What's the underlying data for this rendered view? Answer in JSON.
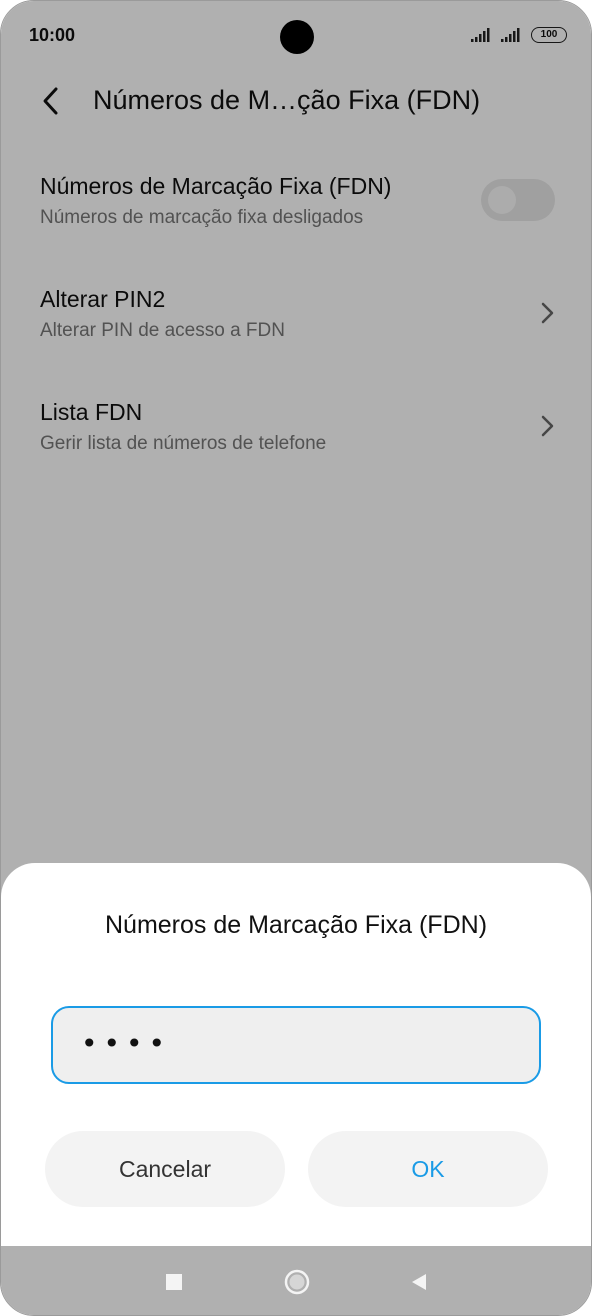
{
  "status_bar": {
    "time": "10:00",
    "battery": "100",
    "icons": [
      "signal-icon",
      "signal-icon",
      "battery-icon"
    ]
  },
  "toolbar": {
    "title": "Números de M…ção Fixa (FDN)",
    "back_icon": "chevron-left-icon"
  },
  "settings": {
    "items": [
      {
        "title": "Números de Marcação Fixa (FDN)",
        "subtitle": "Números de marcação fixa desligados",
        "control": "toggle",
        "enabled": false
      },
      {
        "title": "Alterar PIN2",
        "subtitle": "Alterar PIN de acesso a FDN",
        "control": "chevron-right-icon"
      },
      {
        "title": "Lista FDN",
        "subtitle": "Gerir lista de números de telefone",
        "control": "chevron-right-icon"
      }
    ]
  },
  "dialog": {
    "title": "Números de Marcação Fixa (FDN)",
    "input_value": "••••",
    "cancel_label": "Cancelar",
    "ok_label": "OK"
  },
  "nav_bar": {
    "icons": [
      "recents-square-icon",
      "home-circle-icon",
      "back-triangle-icon"
    ]
  },
  "colors": {
    "accent": "#1a9be6",
    "dim_overlay": "rgba(0,0,0,0.31)"
  }
}
